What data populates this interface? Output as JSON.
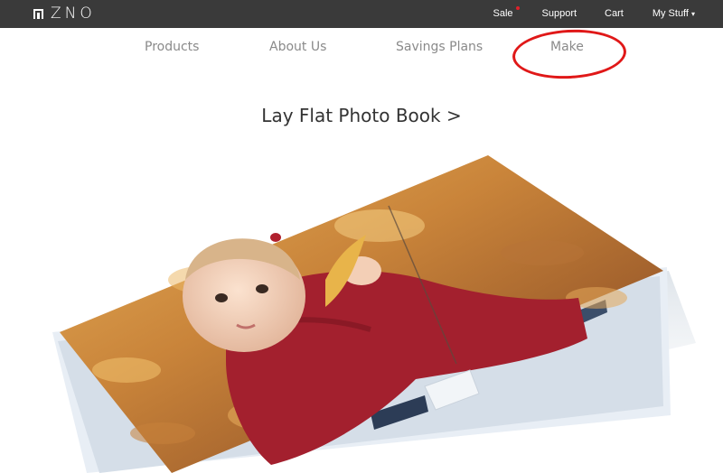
{
  "topbar": {
    "logo_text": "ZNO",
    "links": {
      "sale": "Sale",
      "support": "Support",
      "cart": "Cart",
      "my_stuff": "My Stuff",
      "my_stuff_caret": "▾"
    }
  },
  "main_nav": {
    "products": "Products",
    "about_us": "About Us",
    "savings_plans": "Savings Plans",
    "make": "Make"
  },
  "feature": {
    "headline": "Lay Flat Photo Book >"
  },
  "colors": {
    "topbar_bg": "#3a3a3a",
    "nav_text": "#8a8a8a",
    "headline_text": "#333333",
    "annotation_red": "#e01818",
    "sale_dot": "#e0202a"
  },
  "icons": {
    "logo": "zno-logo-icon",
    "dropdown": "chevron-down-icon"
  }
}
